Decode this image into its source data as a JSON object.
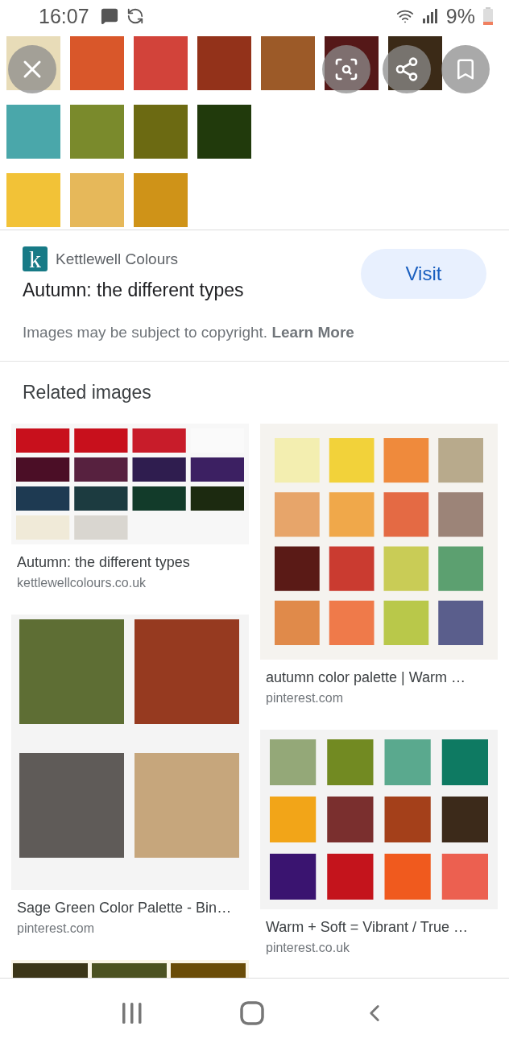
{
  "status_bar": {
    "time": "16:07",
    "battery": "9%"
  },
  "source": {
    "logo_letter": "k",
    "site": "Kettlewell Colours",
    "title": "Autumn: the different types",
    "button": "Visit",
    "notice": "Images may be subject to copyright.",
    "notice_link": "Learn More"
  },
  "related": {
    "heading": "Related images",
    "columns": [
      [
        {
          "caption": "Autumn: the different types",
          "site": "kettlewellcolours.co.uk"
        },
        {
          "caption": "Sage Green Color Palette - Bin…",
          "site": "pinterest.com"
        }
      ],
      [
        {
          "caption": "autumn color palette | Warm …",
          "site": "pinterest.com"
        },
        {
          "caption": "Warm + Soft = Vibrant / True …",
          "site": "pinterest.co.uk"
        }
      ]
    ]
  }
}
